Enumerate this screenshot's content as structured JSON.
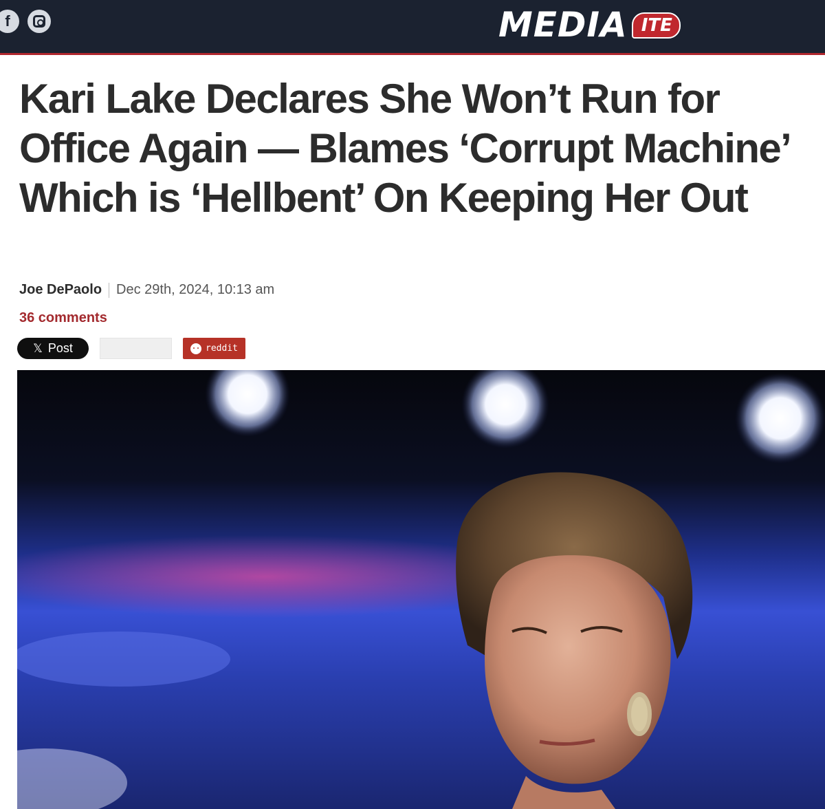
{
  "header": {
    "social": [
      {
        "icon": "facebook-icon",
        "glyph": "f"
      },
      {
        "icon": "instagram-icon"
      }
    ],
    "logo": {
      "main": "MEDIA",
      "badge": "ITE"
    },
    "colors": {
      "bar": "#1b2230",
      "accent": "#b0272e"
    }
  },
  "article": {
    "title": "Kari Lake Declares She Won’t Run for Office Again — Blames ‘Corrupt Machine’ Which is ‘Hellbent’ On Keeping Her Out",
    "author": "Joe DePaolo",
    "date": "Dec 29th, 2024, 10:13 am",
    "comments": "36 comments"
  },
  "share": {
    "x_glyph": "𝕏",
    "x_label": "Post",
    "reddit_label": "reddit"
  },
  "photo": {
    "icon": "article-photo"
  }
}
